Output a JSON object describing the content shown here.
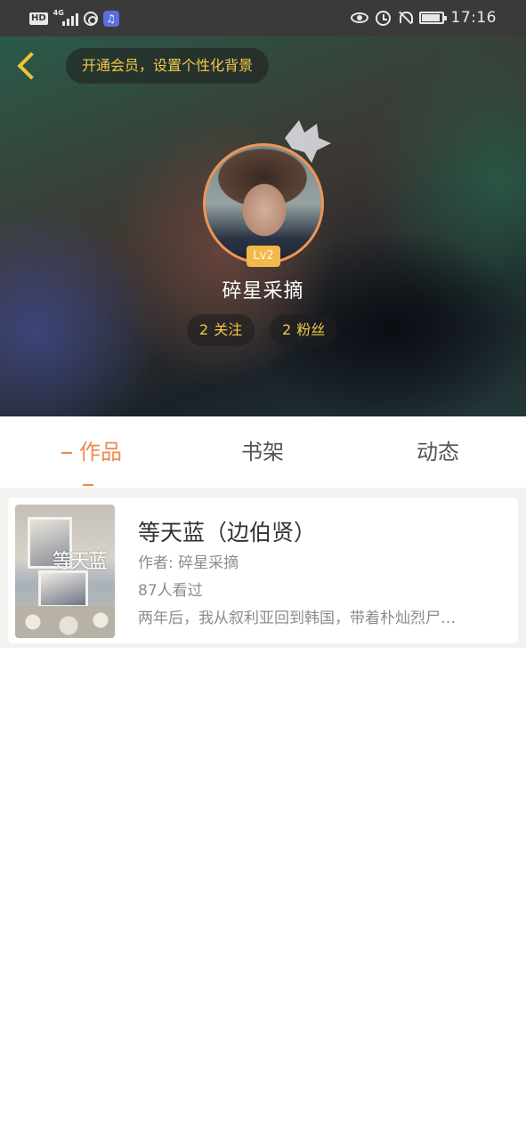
{
  "status_bar": {
    "hd": "HD",
    "network": "4G",
    "time": "17:16",
    "icons": [
      "hd-icon",
      "signal-icon",
      "app-icon",
      "music-icon",
      "eye-icon",
      "alarm-icon",
      "bell-off-icon",
      "battery-icon"
    ]
  },
  "header": {
    "vip_prompt": "开通会员，设置个性化背景",
    "level": "Lv2",
    "username": "碎星采摘",
    "following_count": "2",
    "following_label": "关注",
    "fans_count": "2",
    "fans_label": "粉丝",
    "accent_color": "#f2c84b"
  },
  "tabs": [
    {
      "label": "作品",
      "active": true
    },
    {
      "label": "书架",
      "active": false
    },
    {
      "label": "动态",
      "active": false
    }
  ],
  "works": [
    {
      "cover_text": "等天蓝",
      "title": "等天蓝（边伯贤）",
      "author": "作者: 碎星采摘",
      "views": "87人看过",
      "description": "两年后，我从叙利亚回到韩国，带着朴灿烈尸…"
    }
  ],
  "colors": {
    "active_tab": "#ee8a4a",
    "level_badge": "#f2b84a",
    "avatar_border": "#ef9556"
  }
}
